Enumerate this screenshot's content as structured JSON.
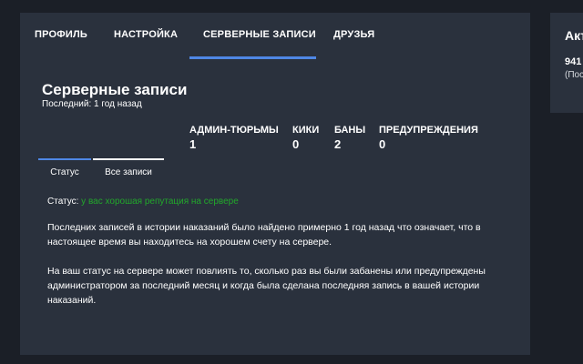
{
  "tabs": [
    {
      "label": "ПРОФИЛЬ"
    },
    {
      "label": "НАСТРОЙКА"
    },
    {
      "label": "СЕРВЕРНЫЕ ЗАПИСИ",
      "active": true
    },
    {
      "label": "ДРУЗЬЯ"
    }
  ],
  "section": {
    "title": "Серверные записи",
    "subtitle": "Последний: 1 год назад"
  },
  "stats": [
    {
      "label": "АДМИН-ТЮРЬМЫ",
      "value": "1"
    },
    {
      "label": "КИКИ",
      "value": "0"
    },
    {
      "label": "БАНЫ",
      "value": "2"
    },
    {
      "label": "ПРЕДУПРЕЖДЕНИЯ",
      "value": "0"
    }
  ],
  "subtabs": [
    {
      "label": "Статус",
      "active": true
    },
    {
      "label": "Все записи"
    }
  ],
  "status": {
    "prefix": "Статус:",
    "value": "у вас хорошая репутация на сервере",
    "value_color": "#22a82b"
  },
  "paragraphs": [
    "Последних записей в истории наказаний было найдено примерно 1 год назад что означает, что в настоящее время вы находитесь на хорошем счету на сервере.",
    "На ваш статус на сервере может повлиять то, сколько раз вы были забанены или предупреждены администратором за последний месяц и когда была сделана последняя запись в вашей истории наказаний."
  ],
  "side": {
    "title": "Акт",
    "value": "941",
    "sub": "(Пос"
  },
  "colors": {
    "accent": "#4f87e5",
    "panel": "#2a313d",
    "background": "#1b1f27"
  }
}
